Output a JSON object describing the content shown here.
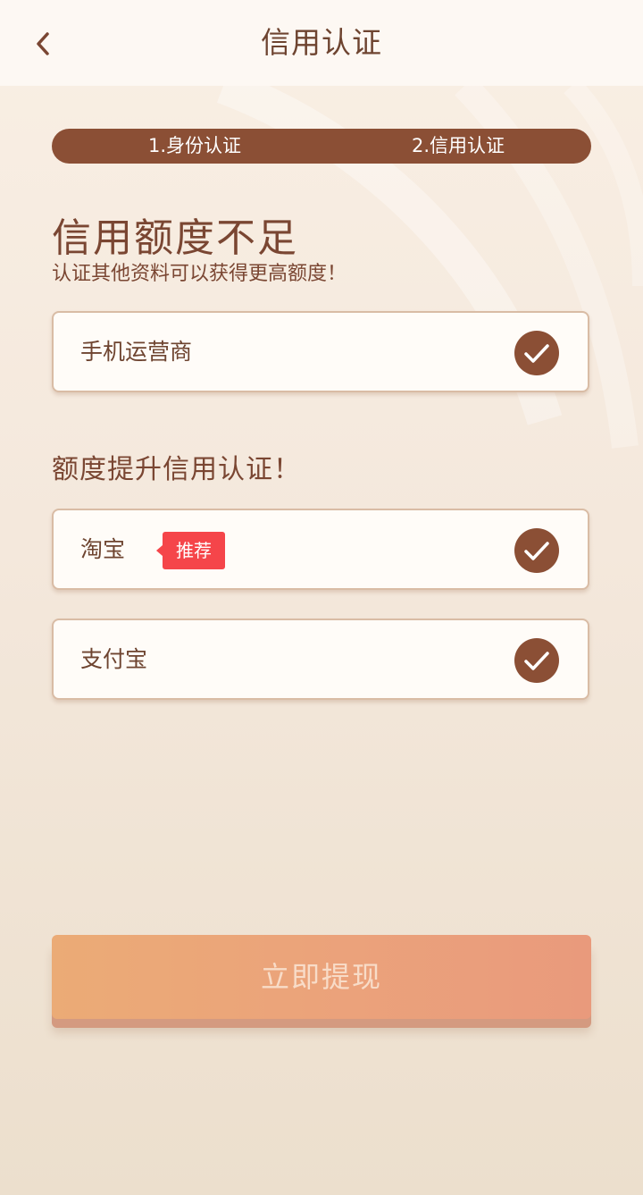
{
  "header": {
    "title": "信用认证"
  },
  "stepper": {
    "step1": "1.身份认证",
    "step2": "2.信用认证"
  },
  "intro": {
    "title": "信用额度不足",
    "subtitle": "认证其他资料可以获得更高额度！"
  },
  "primary_item": {
    "label": "手机运营商",
    "status": "verified"
  },
  "upgrade": {
    "section_title": "额度提升信用认证！",
    "items": [
      {
        "label": "淘宝",
        "badge": "推荐",
        "status": "verified"
      },
      {
        "label": "支付宝",
        "status": "verified"
      }
    ]
  },
  "action": {
    "withdraw_label": "立即提现"
  },
  "colors": {
    "brand_brown": "#8b4f35",
    "text_brown": "#7a4632",
    "badge_red": "#f5454a",
    "button_gradient_start": "#ebab76",
    "button_gradient_end": "#e99a7c"
  },
  "icons": {
    "back": "chevron-left-icon",
    "verified": "check-circle-icon"
  }
}
